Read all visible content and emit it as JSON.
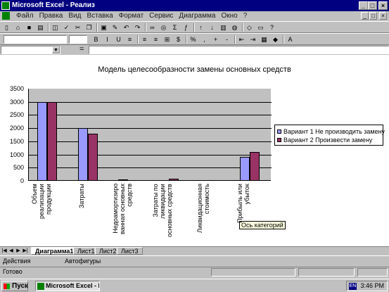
{
  "window": {
    "title": "Microsoft Excel - Реализ",
    "buttons": [
      "_",
      "□",
      "×"
    ]
  },
  "menubar": {
    "items": [
      "Файл",
      "Правка",
      "Вид",
      "Вставка",
      "Формат",
      "Сервис",
      "Диаграмма",
      "Окно",
      "?"
    ],
    "doc_buttons": [
      "_",
      "□",
      "×"
    ]
  },
  "toolbar_standard": {
    "icons": [
      "new-icon",
      "open-icon",
      "save-icon",
      "print-icon",
      "preview-icon",
      "spell-icon",
      "cut-icon",
      "copy-icon",
      "paste-icon",
      "format-painter-icon",
      "undo-icon",
      "redo-icon",
      "hyperlink-icon",
      "web-icon",
      "autosum-icon",
      "function-icon",
      "sort-asc-icon",
      "sort-desc-icon",
      "chart-wizard-icon",
      "map-icon",
      "drawing-icon",
      "zoom-icon",
      "help-icon"
    ]
  },
  "toolbar_formatting": {
    "icons": [
      "bold-icon",
      "italic-icon",
      "underline-icon",
      "align-left-icon",
      "align-center-icon",
      "align-right-icon",
      "merge-icon",
      "currency-icon",
      "percent-icon",
      "comma-icon",
      "increase-decimal-icon",
      "decrease-decimal-icon",
      "indent-decrease-icon",
      "indent-increase-icon",
      "borders-icon",
      "fill-color-icon",
      "font-color-icon"
    ]
  },
  "formulabar": {
    "name_box": "",
    "equals": "=",
    "value": ""
  },
  "chart_data": {
    "type": "bar",
    "title": "Модель целесообразности замены основных средств",
    "categories": [
      "Объем\nреализации\nпродукции",
      "Затраты",
      "Недоамортизиро\nванная основных\nсредств",
      "Затраты по\nликвидации\nосновных средств",
      "Ликвидационная\nстоимость",
      "Прибыль или\nубыток"
    ],
    "series": [
      {
        "name": "Вариант 1 Не производить замену",
        "color": "#9999ff",
        "values": [
          3000,
          2000,
          50,
          0,
          0,
          900
        ]
      },
      {
        "name": "Вариант 2 Произвести замену",
        "color": "#993366",
        "values": [
          3000,
          1800,
          0,
          70,
          0,
          1100
        ]
      }
    ],
    "yticks": [
      "3500",
      "3000",
      "2500",
      "2000",
      "1500",
      "1000",
      "500",
      "0"
    ],
    "ylim": [
      0,
      3500
    ],
    "grid": true,
    "legend": "right",
    "plot_background": "#c0c0c0"
  },
  "tooltip": {
    "text": "Ось категорий"
  },
  "sheettabs": {
    "tabs": [
      "Диаграмма1",
      "Лист1",
      "Лист2",
      "Лист3"
    ],
    "active": 0
  },
  "drawbar": {
    "actions_label": "Действия",
    "autoshapes_label": "Автофигуры"
  },
  "statusbar": {
    "text": "Готово"
  },
  "taskbar": {
    "start_label": "Пуск",
    "task_label": "Microsoft Excel - Реал",
    "time": "3:46 PM",
    "lang": "EN"
  }
}
